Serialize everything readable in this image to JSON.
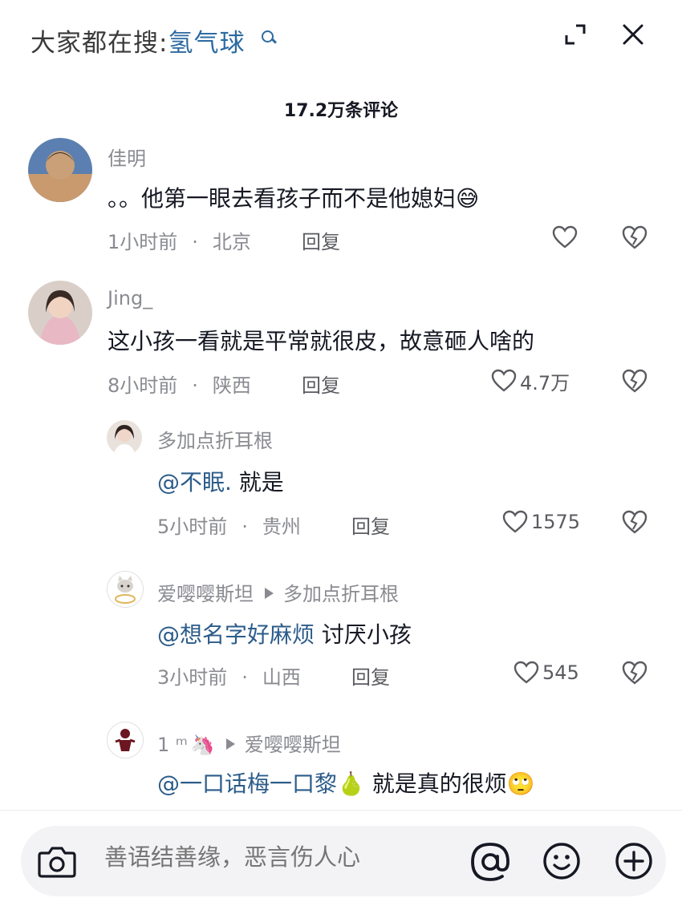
{
  "header": {
    "search_prefix": "大家都在搜:",
    "search_term": "氢气球"
  },
  "comment_count": "17.2万条评论",
  "comments": [
    {
      "user": "佳明",
      "text": "。。他第一眼去看孩子而不是他媳妇",
      "time": "1小时前",
      "location": "北京",
      "reply": "回复",
      "likes": ""
    },
    {
      "user": "Jing_",
      "text": "这小孩一看就是平常就很皮，故意砸人啥的",
      "time": "8小时前",
      "location": "陕西",
      "reply": "回复",
      "likes": "4.7万"
    }
  ],
  "replies": [
    {
      "user": "多加点折耳根",
      "reply_to": "",
      "mention": "@不眠.",
      "text": " 就是",
      "time": "5小时前",
      "location": "贵州",
      "reply": "回复",
      "likes": "1575"
    },
    {
      "user": "爱嘤嘤斯坦",
      "reply_to": "多加点折耳根",
      "mention": "@想名字好麻烦",
      "text": " 讨厌小孩",
      "time": "3小时前",
      "location": "山西",
      "reply": "回复",
      "likes": "545"
    },
    {
      "user": "1 ᵐ",
      "reply_to": "爱嘤嘤斯坦",
      "mention": "@一口话梅一口黎",
      "text": " 就是真的很烦",
      "time": "",
      "location": "",
      "reply": "",
      "likes": ""
    }
  ],
  "input": {
    "placeholder": "善语结善缘，恶言伤人心"
  },
  "icons": [
    "search-icon",
    "expand-icon",
    "close-icon",
    "heart-icon",
    "broken-heart-icon",
    "camera-icon",
    "at-icon",
    "emoji-icon",
    "plus-icon"
  ],
  "colors": {
    "accent": "#2c6aa0",
    "mention": "#2c5c8a",
    "muted": "#8a8b91"
  }
}
